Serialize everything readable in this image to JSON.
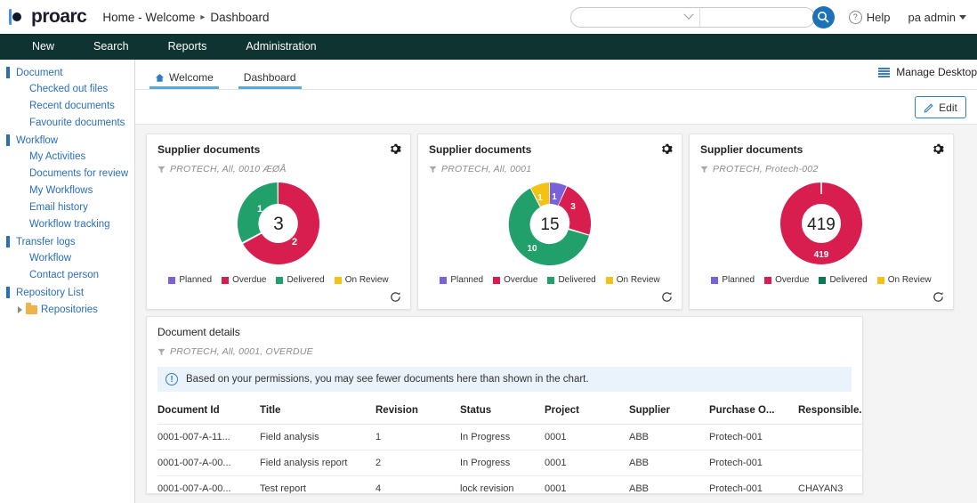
{
  "brand": {
    "name": "proarc",
    "accent": "#2f7ec1",
    "navbar_bg": "#0e3331"
  },
  "breadcrumb": {
    "home": "Home - Welcome",
    "separator": "▸",
    "current": "Dashboard"
  },
  "search": {
    "scope_value": "",
    "scope_placeholder": "",
    "query_value": "",
    "query_placeholder": ""
  },
  "header": {
    "help_label": "Help",
    "user_label": "pa admin"
  },
  "mainnav": {
    "items": [
      {
        "label": "New"
      },
      {
        "label": "Search"
      },
      {
        "label": "Reports"
      },
      {
        "label": "Administration"
      }
    ]
  },
  "sidebar": {
    "groups": [
      {
        "label": "Document",
        "items": [
          {
            "label": "Checked out files"
          },
          {
            "label": "Recent documents"
          },
          {
            "label": "Favourite documents"
          }
        ]
      },
      {
        "label": "Workflow",
        "items": [
          {
            "label": "My Activities"
          },
          {
            "label": "Documents for review"
          },
          {
            "label": "My Workflows"
          },
          {
            "label": "Email history"
          },
          {
            "label": "Workflow tracking"
          }
        ]
      },
      {
        "label": "Transfer logs",
        "items": [
          {
            "label": "Workflow"
          },
          {
            "label": "Contact person"
          }
        ]
      },
      {
        "label": "Repository List",
        "items": []
      }
    ],
    "tree_node": "Repositories"
  },
  "tabs": {
    "items": [
      {
        "label": "Welcome",
        "icon": "home-icon",
        "active": true
      },
      {
        "label": "Dashboard",
        "icon": "",
        "active": true
      }
    ]
  },
  "toolbar": {
    "manage_desktop_label": "Manage Desktop",
    "edit_label": "Edit"
  },
  "legend": [
    {
      "label": "Planned",
      "color": "#7b61d8"
    },
    {
      "label": "Overdue",
      "color": "#d81e4e"
    },
    {
      "label": "Delivered",
      "color": "#22a06b"
    },
    {
      "label": "On Review",
      "color": "#f2c314"
    }
  ],
  "chart_data": [
    {
      "type": "pie",
      "title": "Supplier documents",
      "subtitle": "PROTECH, All, 0010 ÆØÅ",
      "center_total": "3",
      "categories": [
        "Planned",
        "Overdue",
        "Delivered",
        "On Review"
      ],
      "values": [
        0,
        2,
        1,
        0
      ],
      "slice_labels": [
        "",
        "2",
        "1",
        ""
      ],
      "colors": [
        "#7b61d8",
        "#d81e4e",
        "#22a06b",
        "#f2c314"
      ],
      "legend_position": "bottom",
      "donut": true
    },
    {
      "type": "pie",
      "title": "Supplier documents",
      "subtitle": "PROTECH, All, 0001",
      "center_total": "15",
      "categories": [
        "Planned",
        "Overdue",
        "Delivered",
        "On Review"
      ],
      "values": [
        1,
        3,
        10,
        1
      ],
      "slice_labels": [
        "1",
        "3",
        "10",
        "1"
      ],
      "colors": [
        "#7b61d8",
        "#d81e4e",
        "#22a06b",
        "#f2c314"
      ],
      "legend_position": "bottom",
      "donut": true
    },
    {
      "type": "pie",
      "title": "Supplier documents",
      "subtitle": "PROTECH, Protech-002",
      "center_total": "419",
      "categories": [
        "Planned",
        "Overdue",
        "Delivered",
        "On Review"
      ],
      "values": [
        0,
        419,
        0,
        0
      ],
      "slice_labels": [
        "",
        "419",
        "",
        ""
      ],
      "colors": [
        "#7b61d8",
        "#d81e4e",
        "#22a06b",
        "#f2c314"
      ],
      "legend_position": "bottom",
      "donut": true
    }
  ],
  "details": {
    "title": "Document details",
    "subtitle": "PROTECH, All, 0001, OVERDUE",
    "info_message": "Based on your permissions, you may see fewer documents here than shown in the chart.",
    "columns": [
      "Document Id",
      "Title",
      "Revision",
      "Status",
      "Project",
      "Supplier",
      "Purchase O...",
      "Responsible..."
    ],
    "rows": [
      [
        "0001-007-A-11...",
        "Field analysis",
        "1",
        "In Progress",
        "0001",
        "ABB",
        "Protech-001",
        ""
      ],
      [
        "0001-007-A-00...",
        "Field analysis report",
        "2",
        "In Progress",
        "0001",
        "ABB",
        "Protech-001",
        ""
      ],
      [
        "0001-007-A-00...",
        "Test report",
        "4",
        "lock revision",
        "0001",
        "ABB",
        "Protech-001",
        "CHAYAN3"
      ]
    ]
  }
}
